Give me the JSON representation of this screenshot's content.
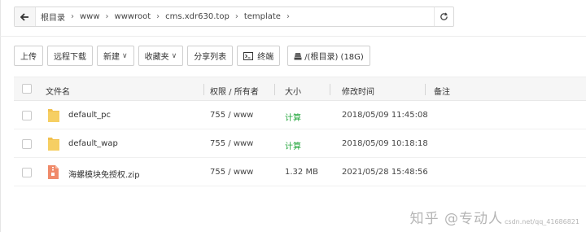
{
  "breadcrumb": [
    "根目录",
    "www",
    "wwwroot",
    "cms.xdr630.top",
    "template"
  ],
  "toolbar": {
    "upload": "上传",
    "remote_download": "远程下载",
    "new": "新建",
    "favorites": "收藏夹",
    "share_list": "分享列表",
    "terminal": "终端",
    "disk": "/(根目录) (18G)"
  },
  "table": {
    "headers": {
      "name": "文件名",
      "perm": "权限 / 所有者",
      "size": "大小",
      "mtime": "修改时间",
      "note": "备注"
    },
    "rows": [
      {
        "name": "default_pc",
        "perm": "755 / www",
        "size": "计算",
        "mtime": "2018/05/09 11:45:08",
        "type": "folder"
      },
      {
        "name": "default_wap",
        "perm": "755 / www",
        "size": "计算",
        "mtime": "2018/05/09 10:18:18",
        "type": "folder"
      },
      {
        "name": "海螺模块免授权.zip",
        "perm": "755 / www",
        "size": "1.32 MB",
        "mtime": "2021/05/28 15:48:56",
        "type": "zip"
      }
    ]
  },
  "watermark": {
    "main": "知乎 @专动人",
    "sub": "csdn.net/qq_41686821"
  },
  "colors": {
    "calc_link": "#20a53a",
    "folder": "#f2c14e",
    "zip": "#f08a6a"
  }
}
